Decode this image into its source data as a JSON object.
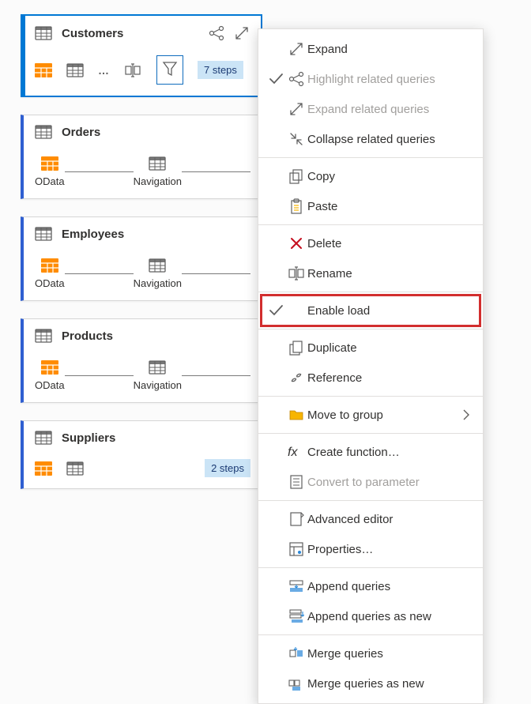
{
  "cards": {
    "customers": {
      "title": "Customers",
      "steps_label": "7 steps"
    },
    "orders": {
      "title": "Orders",
      "step1": "OData",
      "step2": "Navigation"
    },
    "employees": {
      "title": "Employees",
      "step1": "OData",
      "step2": "Navigation"
    },
    "products": {
      "title": "Products",
      "step1": "OData",
      "step2": "Navigation"
    },
    "suppliers": {
      "title": "Suppliers",
      "steps_label": "2 steps"
    }
  },
  "menu": {
    "expand": "Expand",
    "highlight_related": "Highlight related queries",
    "expand_related": "Expand related queries",
    "collapse_related": "Collapse related queries",
    "copy": "Copy",
    "paste": "Paste",
    "delete": "Delete",
    "rename": "Rename",
    "enable_load": "Enable load",
    "duplicate": "Duplicate",
    "reference": "Reference",
    "move_to_group": "Move to group",
    "create_function": "Create function…",
    "convert_to_parameter": "Convert to parameter",
    "advanced_editor": "Advanced editor",
    "properties": "Properties…",
    "append_queries": "Append queries",
    "append_queries_as_new": "Append queries as new",
    "merge_queries": "Merge queries",
    "merge_queries_as_new": "Merge queries as new"
  }
}
